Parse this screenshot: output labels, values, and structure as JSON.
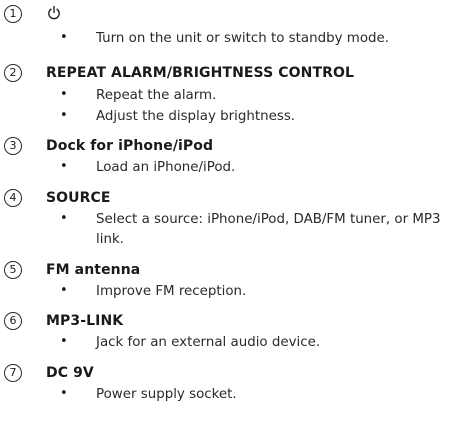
{
  "items": [
    {
      "number": "1",
      "title": "",
      "title_icon": "power-icon",
      "bullets": [
        "Turn on the unit or switch to standby mode."
      ]
    },
    {
      "number": "2",
      "title": "REPEAT ALARM/BRIGHTNESS CONTROL",
      "bullets": [
        "Repeat the alarm.",
        "Adjust the display brightness."
      ]
    },
    {
      "number": "3",
      "title": "Dock for iPhone/iPod",
      "bullets": [
        "Load an iPhone/iPod."
      ]
    },
    {
      "number": "4",
      "title": "SOURCE",
      "bullets": [
        "Select a source: iPhone/iPod, DAB/FM tuner, or MP3 link."
      ]
    },
    {
      "number": "5",
      "title": "FM antenna",
      "bullets": [
        "Improve FM reception."
      ]
    },
    {
      "number": "6",
      "title": "MP3-LINK",
      "bullets": [
        "Jack for an external audio device."
      ]
    },
    {
      "number": "7",
      "title": "DC 9V",
      "bullets": [
        "Power supply socket."
      ]
    }
  ],
  "bullet_char": "•"
}
